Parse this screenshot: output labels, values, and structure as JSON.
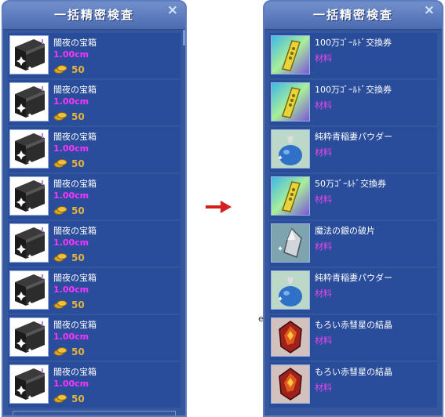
{
  "left_panel": {
    "title": "一括精密検査",
    "close": "×",
    "items": [
      {
        "name": "闇夜の宝箱",
        "size": "1.00cm",
        "price": "50"
      },
      {
        "name": "闇夜の宝箱",
        "size": "1.00cm",
        "price": "50"
      },
      {
        "name": "闇夜の宝箱",
        "size": "1.00cm",
        "price": "50"
      },
      {
        "name": "闇夜の宝箱",
        "size": "1.00cm",
        "price": "50"
      },
      {
        "name": "闇夜の宝箱",
        "size": "1.00cm",
        "price": "50"
      },
      {
        "name": "闇夜の宝箱",
        "size": "1.00cm",
        "price": "50"
      },
      {
        "name": "闇夜の宝箱",
        "size": "1.00cm",
        "price": "50"
      },
      {
        "name": "闇夜の宝箱",
        "size": "1.00cm",
        "price": "50"
      }
    ]
  },
  "right_panel": {
    "title": "一括精密検査",
    "close": "×",
    "items": [
      {
        "name": "100万ｺﾞｰﾙﾄﾞ交換券",
        "category": "材料",
        "icon": "gold-ticket-icon"
      },
      {
        "name": "100万ｺﾞｰﾙﾄﾞ交換券",
        "category": "材料",
        "icon": "gold-ticket-icon"
      },
      {
        "name": "純粋青稲妻パウダー",
        "category": "材料",
        "icon": "blue-powder-bag-icon"
      },
      {
        "name": "50万ｺﾞｰﾙﾄﾞ交換券",
        "category": "材料",
        "icon": "gold-ticket-icon"
      },
      {
        "name": "魔法の銀の破片",
        "category": "材料",
        "icon": "silver-shard-icon"
      },
      {
        "name": "純粋青稲妻パウダー",
        "category": "材料",
        "icon": "blue-powder-bag-icon"
      },
      {
        "name": "もろい赤彗星の結晶",
        "category": "材料",
        "icon": "red-crystal-icon"
      },
      {
        "name": "もろい赤彗星の結晶",
        "category": "材料",
        "icon": "red-crystal-icon"
      }
    ]
  },
  "colors": {
    "panel": "#35579c",
    "size_text": "#ff33ff",
    "price_text": "#e2b23c",
    "arrow": "#d42020"
  }
}
